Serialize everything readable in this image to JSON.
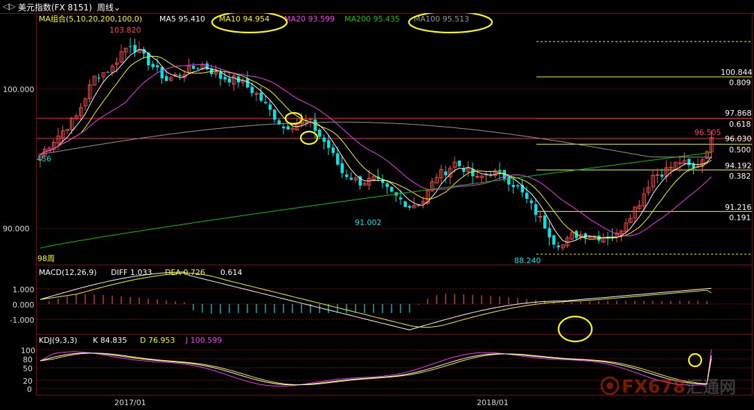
{
  "toolbar": {
    "symbol_label": "美元指数(FX 8151)",
    "period_label": "周线"
  },
  "main_panel": {
    "ma_group_label": "MA组合(5,10,20,200,100,0)",
    "ma_values": [
      {
        "label": "MA5 95.410",
        "color": "#ffffff"
      },
      {
        "label": "MA10 94.954",
        "color": "#ffff00"
      },
      {
        "label": "MA20 93.599",
        "color": "#ff33ff"
      },
      {
        "label": "MA200 95.435",
        "color": "#00cc00"
      },
      {
        "label": "MA100 95.513",
        "color": "#999999"
      }
    ],
    "y_ticks": [
      "100.000",
      "90.000"
    ],
    "annotations": {
      "high": "103.820",
      "low_1": "91.002",
      "low_2": "88.240",
      "last": "96.505",
      "left_edge": "456",
      "period_note": "98周"
    },
    "levels": [
      {
        "price": "100.844",
        "ratio": "0.809"
      },
      {
        "price": "97.868",
        "ratio": "0.618"
      },
      {
        "price": "96.030",
        "ratio": "0.500"
      },
      {
        "price": "94.192",
        "ratio": "0.382"
      },
      {
        "price": "91.216",
        "ratio": "0.191"
      }
    ]
  },
  "macd_panel": {
    "title": "MACD(12,26,9)",
    "diff": "DIFF 1.033",
    "dea": "DEA 0.726",
    "macd": "0.614",
    "y_ticks": [
      "1.000",
      "0.000",
      "-1.000"
    ]
  },
  "kdj_panel": {
    "title": "KDJ(9,3,3)",
    "k": "K 84.835",
    "d": "D 76.953",
    "j": "J 100.599",
    "y_ticks": [
      "100",
      "80",
      "50",
      "20",
      "0"
    ]
  },
  "x_axis": {
    "labels": [
      "2017/01",
      "2018/01"
    ]
  },
  "watermark": {
    "logo_text": "FX678",
    "cn_text": "汇通网"
  },
  "colors": {
    "up": "#ff4444",
    "down": "#00e5e5",
    "ma5": "#ffffff",
    "ma10": "#ffff00",
    "ma20": "#ff33ff",
    "ma200": "#00cc00",
    "ma100": "#999999",
    "grid": "#7a0000",
    "highlight": "#ffff00"
  },
  "chart_data": {
    "type": "candlestick",
    "period": "weekly",
    "price_range": [
      87.0,
      104.6
    ],
    "anchors": {
      "high": 103.82,
      "low_1": 91.002,
      "low_2": 88.24,
      "last": 96.505,
      "ma5": 95.41,
      "ma10": 94.954,
      "ma20": 93.599,
      "ma200": 95.435,
      "ma100": 95.513
    },
    "fib_levels": [
      100.844,
      97.868,
      96.03,
      94.192,
      91.216
    ],
    "macd": {
      "diff": 1.033,
      "dea": 0.726,
      "macd": 0.614,
      "range": [
        -2.0,
        1.8
      ]
    },
    "kdj": {
      "k": 84.835,
      "d": 76.953,
      "j": 100.599,
      "range": [
        -10,
        115
      ]
    }
  }
}
